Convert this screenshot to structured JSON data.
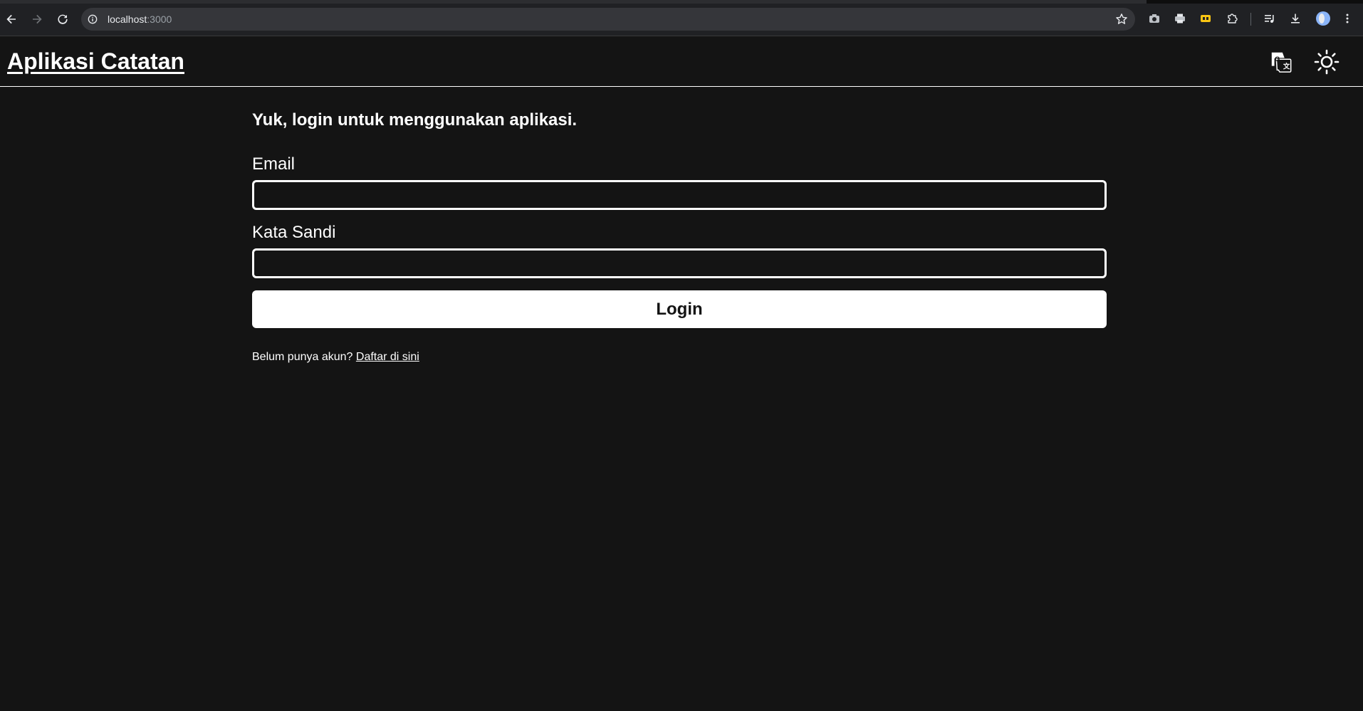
{
  "browser": {
    "url_host": "localhost",
    "url_port": ":3000"
  },
  "header": {
    "title": "Aplikasi Catatan",
    "icons": {
      "translate": "translate-icon",
      "theme": "sun-icon"
    }
  },
  "login": {
    "heading": "Yuk, login untuk menggunakan aplikasi.",
    "email_label": "Email",
    "email_value": "",
    "password_label": "Kata Sandi",
    "password_value": "",
    "submit_label": "Login",
    "register_prompt": "Belum punya akun?",
    "register_link": "Daftar di sini"
  },
  "colors": {
    "background": "#141414",
    "foreground": "#ffffff",
    "chrome": "#202124"
  }
}
